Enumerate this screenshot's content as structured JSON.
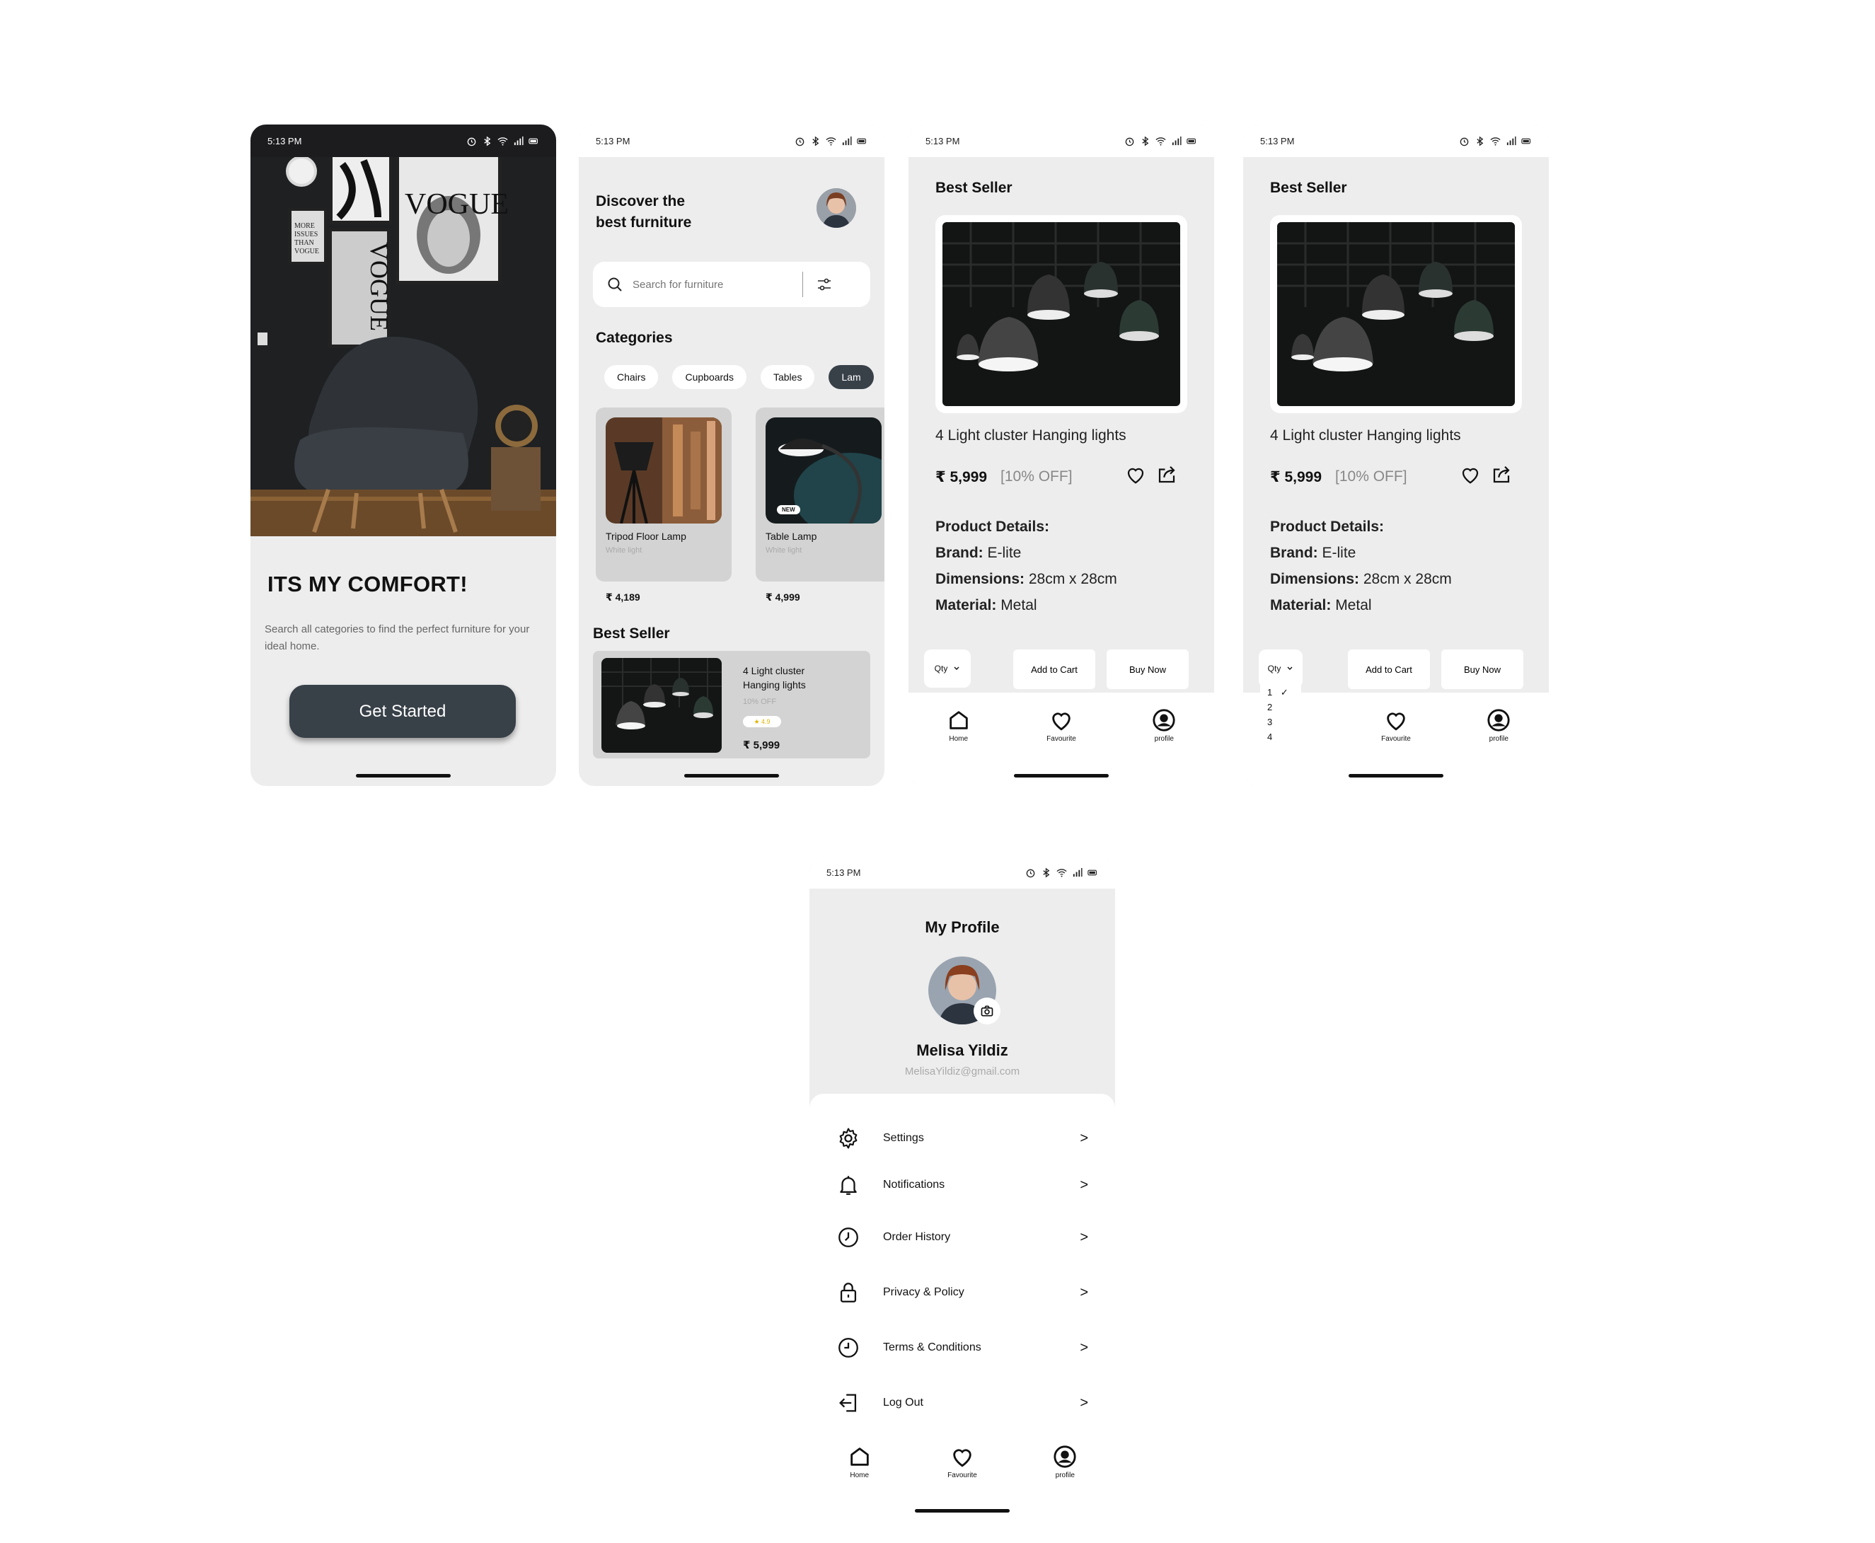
{
  "status_bar": {
    "time": "5:13 PM"
  },
  "onboarding": {
    "title": "ITS MY COMFORT!",
    "description": "Search all categories to find the perfect furniture for your ideal home.",
    "cta": "Get Started",
    "poster_text": "VOGUE",
    "poster_small": "MORE ISSUES THAN VOGUE"
  },
  "home": {
    "heading_line1": "Discover the",
    "heading_line2": "best furniture",
    "search_placeholder": "Search for furniture",
    "categories_title": "Categories",
    "categories": [
      "Chairs",
      "Cupboards",
      "Tables",
      "Lam"
    ],
    "products": [
      {
        "name": "Tripod Floor Lamp",
        "sub": "White light",
        "price": "₹ 4,189"
      },
      {
        "name": "Table  Lamp",
        "sub": "White light",
        "price": "₹  4,999",
        "badge": "NEW"
      }
    ],
    "best_seller_title": "Best Seller",
    "best_seller": {
      "name_line1": "4 Light cluster",
      "name_line2": "Hanging lights",
      "discount": "10% OFF",
      "rating": "★ 4.9",
      "price": "₹ 5,999"
    }
  },
  "detail": {
    "title": "Best Seller",
    "product_name": "4 Light cluster Hanging lights",
    "price": "₹  5,999",
    "discount": "[10% OFF]",
    "details_heading": "Product Details:",
    "brand_label": "Brand:",
    "brand": " E-lite",
    "dimensions_label": "Dimensions:",
    "dimensions": " 28cm x 28cm",
    "material_label": "Material:",
    "material": " Metal",
    "qty": "Qty",
    "qty_options": [
      "1",
      "2",
      "3",
      "4"
    ],
    "add_to_cart": "Add to Cart",
    "buy_now": "Buy Now"
  },
  "nav": {
    "home": "Home",
    "favourite": "Favourite",
    "profile": "profile"
  },
  "profile": {
    "title": "My Profile",
    "name": "Melisa  Yildiz",
    "email": "MelisaYildiz@gmail.com",
    "menu": [
      "Settings",
      "Notifications",
      "Order History",
      "Privacy & Policy",
      "Terms & Conditions",
      "Log Out"
    ],
    "chevron": ">"
  },
  "colors": {
    "accent": "#384048",
    "background": "#ededed"
  }
}
